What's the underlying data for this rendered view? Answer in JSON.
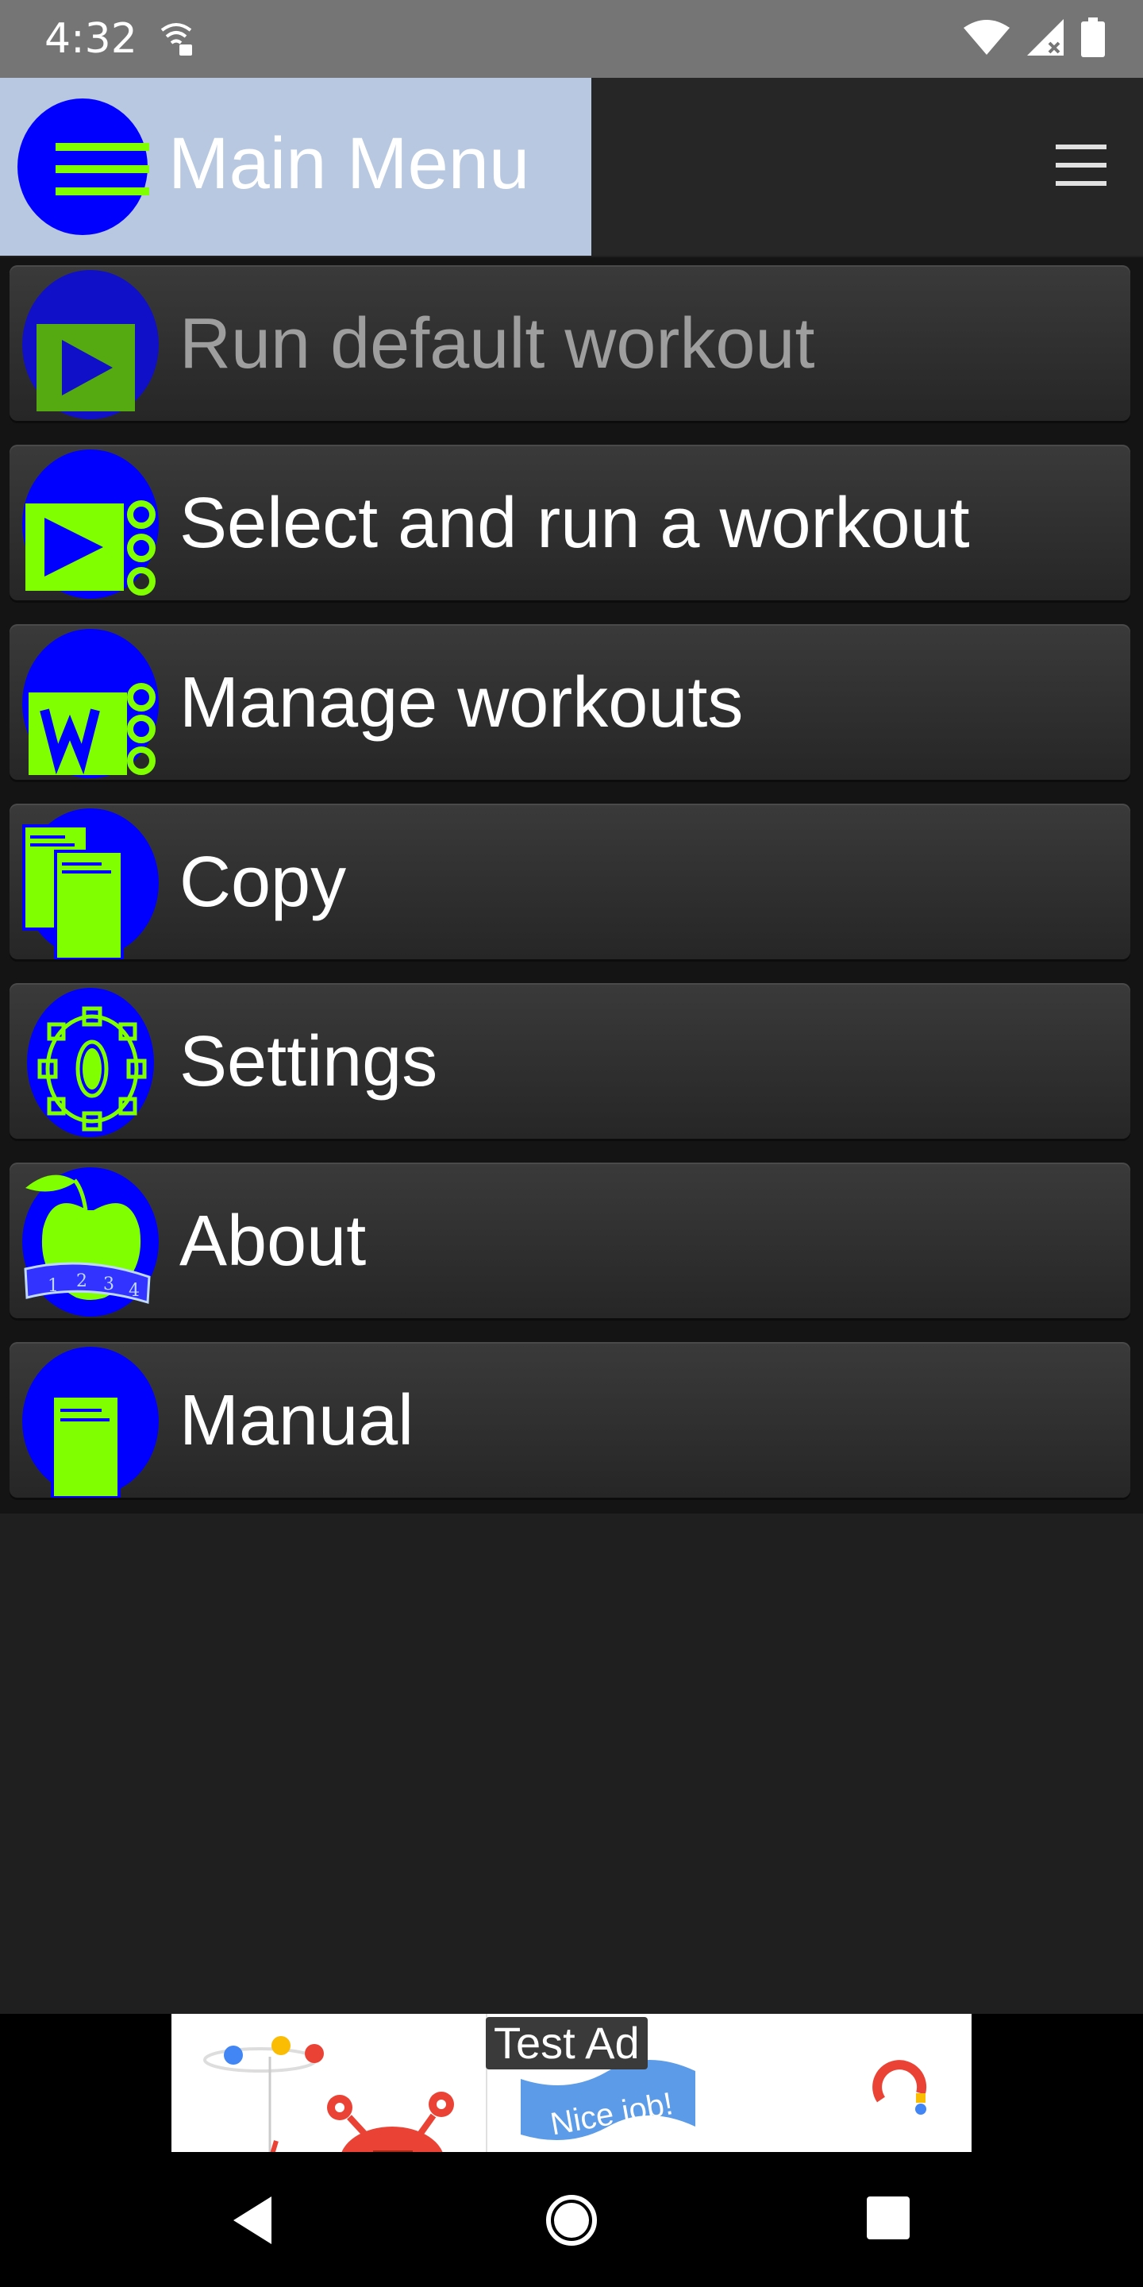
{
  "status_bar": {
    "time": "4:32"
  },
  "header": {
    "title": "Main Menu"
  },
  "menu_items": [
    {
      "label": "Run default workout",
      "enabled": false,
      "icon": "play-icon"
    },
    {
      "label": "Select and run a workout",
      "enabled": true,
      "icon": "play-list-icon"
    },
    {
      "label": "Manage workouts",
      "enabled": true,
      "icon": "workout-list-icon"
    },
    {
      "label": "Copy",
      "enabled": true,
      "icon": "copy-icon"
    },
    {
      "label": "Settings",
      "enabled": true,
      "icon": "gear-icon"
    },
    {
      "label": "About",
      "enabled": true,
      "icon": "apple-icon"
    },
    {
      "label": "Manual",
      "enabled": true,
      "icon": "document-icon"
    }
  ],
  "ad": {
    "label": "Test Ad",
    "banner_text": "Nice job!"
  },
  "colors": {
    "icon_blue": "#0000ff",
    "icon_green": "#7fff00",
    "header_bg": "#b7c8e0"
  }
}
